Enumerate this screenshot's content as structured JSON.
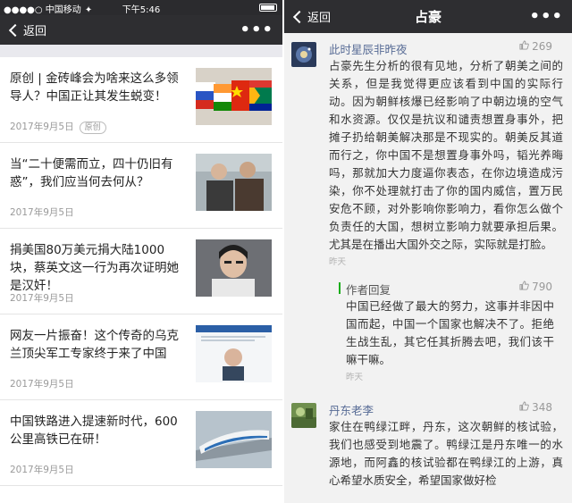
{
  "left_screen": {
    "status": {
      "carrier": "●●●●○ 中国移动",
      "wifi": "✦",
      "time": "下午5:46"
    },
    "nav": {
      "back_label": "返回",
      "more_label": "•••"
    },
    "articles": [
      {
        "title": "原创 | 金砖峰会为啥来这么多领导人？中国正让其发生蜕变！",
        "date": "2017年9月5日",
        "badge": "原创"
      },
      {
        "title": "当“二十便需而立，四十仍旧有惑”，我们应当何去何从？",
        "date": "2017年9月5日",
        "badge": ""
      },
      {
        "title": "捐美国80万美元捐大陆1000块，蔡英文这一行为再次证明她是汉奸！",
        "date": "2017年9月5日",
        "badge": ""
      },
      {
        "title": "网友一片振奋！这个传奇的乌克兰顶尖军工专家终于来了中国",
        "date": "2017年9月5日",
        "badge": ""
      },
      {
        "title": "中国铁路进入提速新时代，600公里高铁已在研！",
        "date": "2017年9月5日",
        "badge": ""
      }
    ]
  },
  "right_screen": {
    "nav": {
      "back_label": "返回",
      "title": "占豪",
      "more_label": "•••"
    },
    "comments": [
      {
        "name": "此时星辰非昨夜",
        "likes": "269",
        "text": "占豪先生分析的很有见地，分析了朝美之间的关系，但是我觉得更应该看到中国的实际行动。因为朝鲜核爆已经影响了中朝边境的空气和水资源。仅仅是抗议和谴责想置身事外，把摊子扔给朝美解决那是不现实的。朝美反其道而行之，你中国不是想置身事外吗，韬光养晦吗，那就加大力度逼你表态，在你边境造成污染，你不处理就打击了你的国内威信，置万民安危不顾，对外影响你影响力，看你怎么做个负责任的大国，想树立影响力就要承担后果。尤其是在播出大国外交之际，实际就是打脸。",
        "time": "昨天",
        "reply": {
          "name": "作者回复",
          "likes": "790",
          "text": "中国已经做了最大的努力，这事并非因中国而起，中国一个国家也解决不了。拒绝生战生乱，其它任其折腾去吧，我们该干嘛干嘛。",
          "time": "昨天"
        }
      },
      {
        "name": "丹东老李",
        "likes": "348",
        "text": "家住在鸭绿江畔，丹东，这次朝鲜的核试验，我们也感受到地震了。鸭绿江是丹东唯一的水源地，而阿鑫的核试验都在鸭绿江的上游，真心希望水质安全，希望国家做好检"
      }
    ],
    "colors": {
      "link": "#576b95",
      "reply_bar": "#1aad19",
      "navbar": "#2e2e31"
    }
  }
}
